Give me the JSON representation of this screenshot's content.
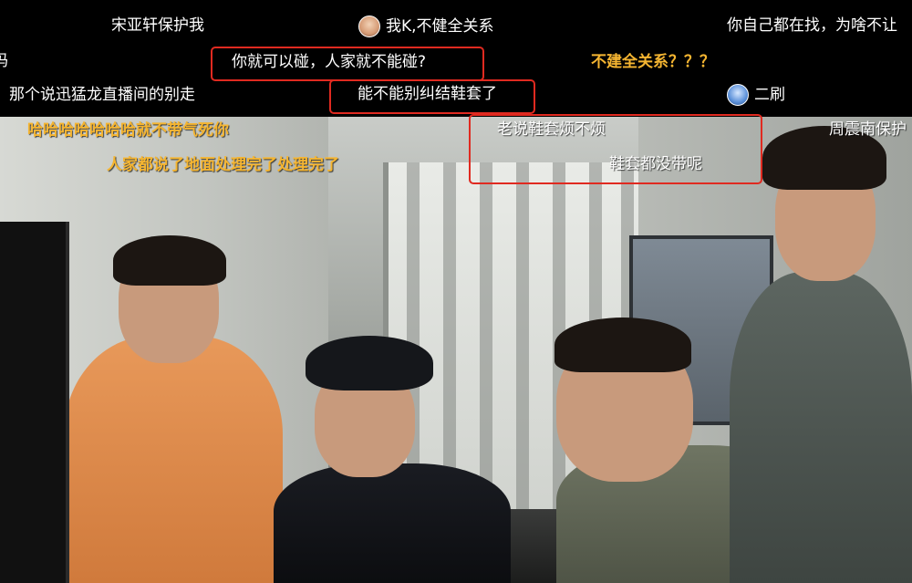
{
  "danmaku": [
    {
      "id": "dm1",
      "text": "宋亚轩保护我",
      "color": "#ffffff"
    },
    {
      "id": "dm2",
      "text": "我K,不健全关系",
      "color": "#ffffff",
      "avatar": "user-avatar"
    },
    {
      "id": "dm3",
      "text": "你自己都在找，为啥不让",
      "color": "#ffffff"
    },
    {
      "id": "dm4",
      "text": "吗",
      "color": "#ffffff"
    },
    {
      "id": "dm5",
      "text": "你就可以碰，人家就不能碰?",
      "color": "#ffffff",
      "highlighted": true
    },
    {
      "id": "dm6",
      "text": "不建全关系？？？",
      "color": "#f5b531"
    },
    {
      "id": "dm7",
      "text": "那个说迅猛龙直播间的别走",
      "color": "#ffffff"
    },
    {
      "id": "dm8",
      "text": "能不能别纠结鞋套了",
      "color": "#ffffff",
      "highlighted": true
    },
    {
      "id": "dm9",
      "text": "二刷",
      "color": "#ffffff",
      "avatar": "user-avatar"
    },
    {
      "id": "dm10",
      "text": "哈哈哈哈哈哈哈就不带气死你",
      "color": "#f5b531"
    },
    {
      "id": "dm11",
      "text": "老说鞋套烦不烦",
      "color": "#ffffff",
      "highlighted": true
    },
    {
      "id": "dm12",
      "text": "周震南保护",
      "color": "#ffffff"
    },
    {
      "id": "dm13",
      "text": "人家都说了地面处理完了处理完了",
      "color": "#f5b531"
    },
    {
      "id": "dm14",
      "text": "鞋套都没带呢",
      "color": "#ffffff",
      "highlighted": true
    }
  ],
  "colors": {
    "highlight_box": "#e02a20",
    "danmaku_orange": "#f5b531",
    "danmaku_white": "#ffffff",
    "band_background": "#000000"
  }
}
